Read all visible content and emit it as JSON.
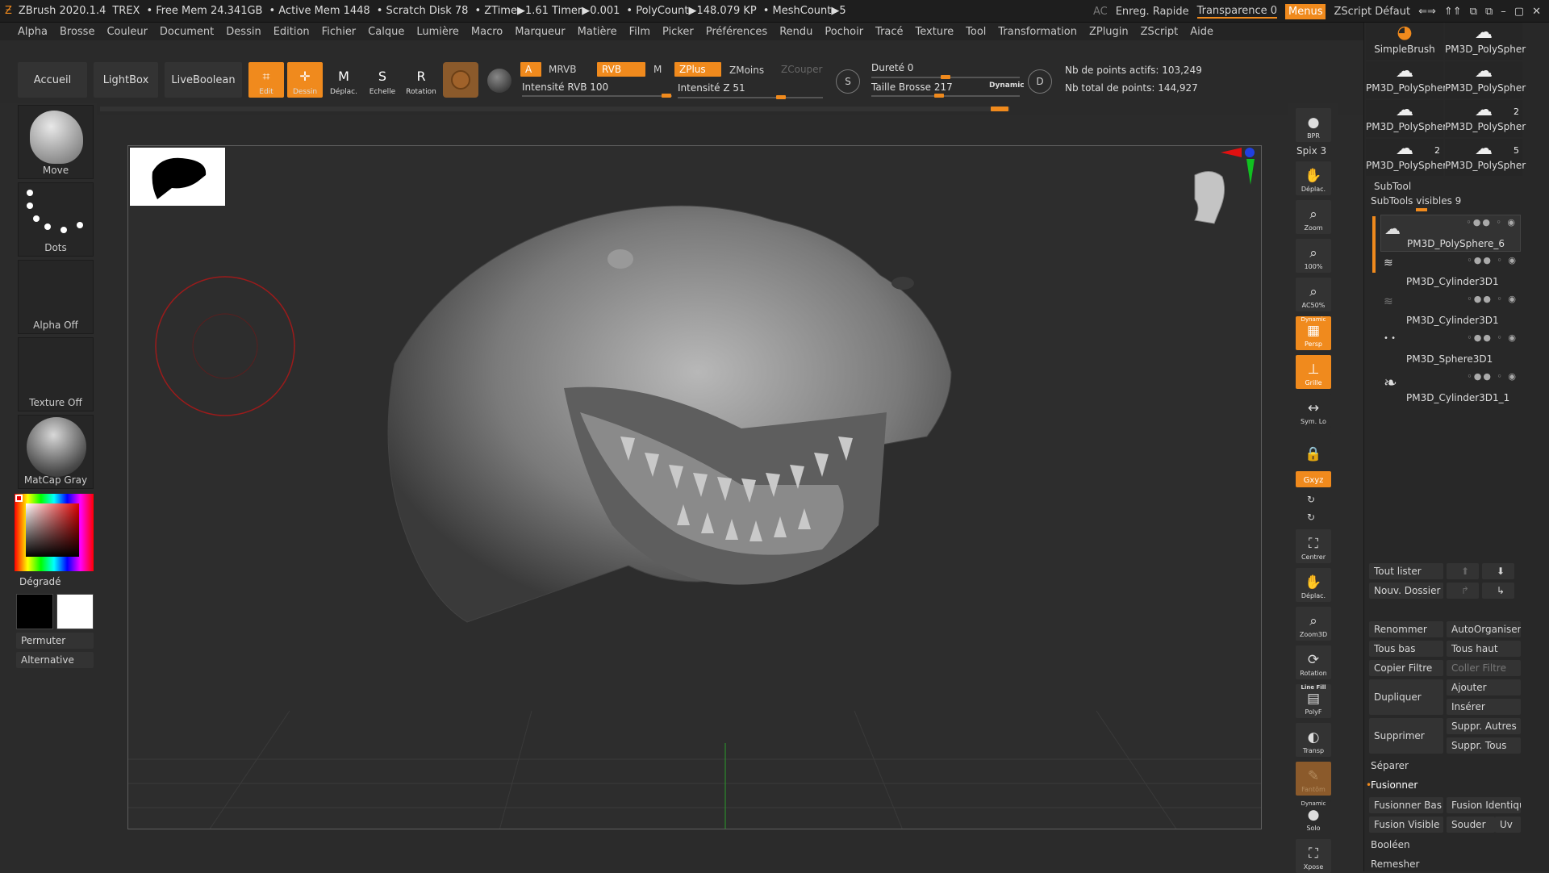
{
  "titlebar": {
    "app": "ZBrush 2020.1.4",
    "doc": "TREX",
    "free_mem": "• Free Mem 24.341GB",
    "active_mem": "• Active Mem 1448",
    "scratch": "• Scratch Disk 78",
    "ztime": "• ZTime▶1.61 Timer▶0.001",
    "polycount": "• PolyCount▶148.079 KP",
    "meshcount": "• MeshCount▶5",
    "ac": "AC",
    "quicksave": "Enreg. Rapide",
    "transparency": "Transparence 0",
    "menus": "Menus",
    "script": "ZScript Défaut"
  },
  "menu": [
    "Alpha",
    "Brosse",
    "Couleur",
    "Document",
    "Dessin",
    "Edition",
    "Fichier",
    "Calque",
    "Lumière",
    "Macro",
    "Marqueur",
    "Matière",
    "Film",
    "Picker",
    "Préférences",
    "Rendu",
    "Pochoir",
    "Tracé",
    "Texture",
    "Tool",
    "Transformation",
    "ZPlugin",
    "ZScript",
    "Aide"
  ],
  "shelf": {
    "home": "Accueil",
    "lightbox": "LightBox",
    "liveboolean": "LiveBoolean",
    "edit": "Edit",
    "draw": "Dessin",
    "move": "Déplac.",
    "scale": "Echelle",
    "rotate": "Rotation",
    "a": "A",
    "mrgb": "MRVB",
    "rgb": "RVB",
    "m": "M",
    "zadd": "ZPlus",
    "zsub": "ZMoins",
    "zcut": "ZCouper",
    "rgb_intensity": "Intensité RVB 100",
    "z_intensity": "Intensité Z 51",
    "hardness": "Dureté 0",
    "brush_size": "Taille Brosse 217",
    "dynamic": "Dynamic",
    "active_points": "Nb de points actifs: 103,249",
    "total_points": "Nb total de points: 144,927"
  },
  "left": {
    "brush": "Move",
    "stroke": "Dots",
    "alpha": "Alpha Off",
    "texture": "Texture Off",
    "material": "MatCap Gray",
    "gradient": "Dégradé",
    "switch": "Permuter",
    "alternate": "Alternative"
  },
  "right_shelf": {
    "bpr": "BPR",
    "spix": "Spix 3",
    "move": "Déplac.",
    "zoom": "Zoom",
    "actual": "100%",
    "aahalf": "AC50%",
    "dyn": "Dynamic",
    "persp": "Persp",
    "floor": "Grille",
    "sym": "Sym. Lo",
    "lock": "",
    "xyz": "Gxyz",
    "frame": "Centrer",
    "move2": "Déplac.",
    "zoom3d": "Zoom3D",
    "rotate": "Rotation",
    "linefill": "Line Fill",
    "polyf": "PolyF",
    "transp": "Transp",
    "ghost": "Fantôm",
    "dyn2": "Dynamic",
    "solo": "Solo",
    "xpose": "Xpose"
  },
  "tray": {
    "tools": [
      {
        "name": "SimpleBrush",
        "n": ""
      },
      {
        "name": "PM3D_PolySpher",
        "n": ""
      },
      {
        "name": "PM3D_PolySpher",
        "n": ""
      },
      {
        "name": "PM3D_PolySpher",
        "n": ""
      },
      {
        "name": "PM3D_PolySpher",
        "n": ""
      },
      {
        "name": "PM3D_PolySpher",
        "n": "2"
      },
      {
        "name": "PM3D_PolySpher",
        "n": "2"
      },
      {
        "name": "PM3D_PolySpher",
        "n": "5"
      }
    ],
    "subtool_title": "SubTool",
    "visible": "SubTools visibles 9",
    "subtools": [
      "PM3D_PolySphere_6",
      "PM3D_Cylinder3D1",
      "PM3D_Cylinder3D1",
      "PM3D_Sphere3D1",
      "PM3D_Cylinder3D1_1"
    ],
    "list_all": "Tout lister",
    "new_folder": "Nouv. Dossier",
    "rename": "Renommer",
    "autoreorder": "AutoOrganiser",
    "all_low": "Tous bas",
    "all_high": "Tous haut",
    "copy_filter": "Copier Filtre",
    "paste_filter": "Coller Filtre",
    "duplicate": "Dupliquer",
    "append": "Ajouter",
    "insert": "Insérer",
    "delete": "Supprimer",
    "delete_other": "Suppr. Autres",
    "delete_all": "Suppr. Tous",
    "split": "Séparer",
    "merge": "Fusionner",
    "merge_down": "Fusionner Bas",
    "merge_similar": "Fusion Identique",
    "merge_visible": "Fusion Visible",
    "weld": "Souder",
    "uv": "Uv",
    "boolean": "Booléen",
    "remesh": "Remesher"
  },
  "colors": {
    "accent": "#f08a1d",
    "bg": "#2b2b2b",
    "viewport": "#2d2d2d"
  }
}
